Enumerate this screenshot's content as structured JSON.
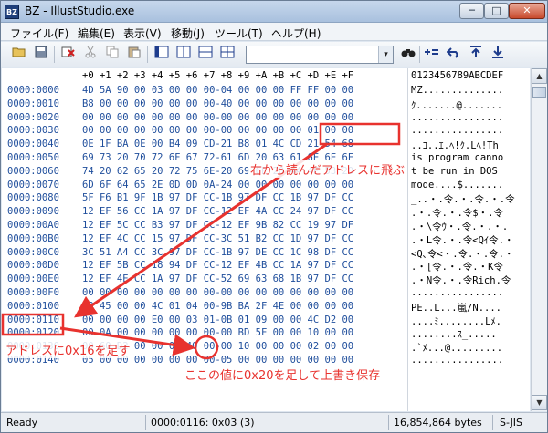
{
  "window": {
    "title": "BZ - IllustStudio.exe",
    "app_icon_text": "BZ",
    "minimize": "─",
    "maximize": "□",
    "close": "✕"
  },
  "menu": [
    "ファイル(F)",
    "編集(E)",
    "表示(V)",
    "移動(J)",
    "ツール(T)",
    "ヘルプ(H)"
  ],
  "toolbar": {
    "combo_value": "",
    "combo_arrow": "▾"
  },
  "hex": {
    "header_cols": "+0 +1 +2 +3 +4 +5 +6 +7 +8 +9 +A +B +C +D +E +F",
    "header_ascii": "0123456789ABCDEF",
    "rows": [
      {
        "addr": "0000:0000",
        "bytes": "4D 5A 90 00 03 00 00 00-04 00 00 00 FF FF 00 00",
        "ascii": "MZ.............."
      },
      {
        "addr": "0000:0010",
        "bytes": "B8 00 00 00 00 00 00 00-40 00 00 00 00 00 00 00",
        "ascii": "ｸ.......@......."
      },
      {
        "addr": "0000:0020",
        "bytes": "00 00 00 00 00 00 00 00-00 00 00 00 00 00 00 00",
        "ascii": "................"
      },
      {
        "addr": "0000:0030",
        "bytes": "00 00 00 00 00 00 00 00-00 00 00 00 00 01 00 00",
        "ascii": "................"
      },
      {
        "addr": "0000:0040",
        "bytes": "0E 1F BA 0E 00 B4 09 CD-21 B8 01 4C CD 21 54 68",
        "ascii": "..ｺ..ｴ.ﾍ!ｸ.Lﾍ!Th"
      },
      {
        "addr": "0000:0050",
        "bytes": "69 73 20 70 72 6F 67 72-61 6D 20 63 61 6E 6E 6F",
        "ascii": "is program canno"
      },
      {
        "addr": "0000:0060",
        "bytes": "74 20 62 65 20 72 75 6E-20 69 6E 20 44 4F 53 20",
        "ascii": "t be run in DOS "
      },
      {
        "addr": "0000:0070",
        "bytes": "6D 6F 64 65 2E 0D 0D 0A-24 00 00 00 00 00 00 00",
        "ascii": "mode....$......."
      },
      {
        "addr": "0000:0080",
        "bytes": "5F F6 B1 9F 1B 97 DF CC-1B 97 DF CC 1B 97 DF CC",
        "ascii": "_..・.令.・.令.・.令"
      },
      {
        "addr": "0000:0090",
        "bytes": "12 EF 56 CC 1A 97 DF CC-12 EF 4A CC 24 97 DF CC",
        "ascii": ".・.令.・.令$・.令"
      },
      {
        "addr": "0000:00A0",
        "bytes": "12 EF 5C CC B3 97 DF CC-12 EF 9B 82 CC 19 97 DF",
        "ascii": ".・\\令ｳ・.令.・.・."
      },
      {
        "addr": "0000:00B0",
        "bytes": "12 EF 4C CC 15 97 DF CC-3C 51 B2 CC 1D 97 DF CC",
        "ascii": ".・L令.・.令<Qｲ令.・"
      },
      {
        "addr": "0000:00C0",
        "bytes": "3C 51 A4 CC 3C 97 DF CC-1B 97 DE CC 1C 98 DF CC",
        "ascii": "<Q､令<・.令.・.令.・"
      },
      {
        "addr": "0000:00D0",
        "bytes": "12 EF 5B CC 18 94 DF CC-12 EF 4B CC 1A 97 DF CC",
        "ascii": ".・[令.・.令.・K令"
      },
      {
        "addr": "0000:00E0",
        "bytes": "12 EF 4E CC 1A 97 DF CC-52 69 63 68 1B 97 DF CC",
        "ascii": ".・N令.・.令Rich.令"
      },
      {
        "addr": "0000:00F0",
        "bytes": "00 00 00 00 00 00 00 00-00 00 00 00 00 00 00 00",
        "ascii": "................"
      },
      {
        "addr": "0000:0100",
        "bytes": "50 45 00 00 4C 01 04 00-9B BA 2F 4E 00 00 00 00",
        "ascii": "PE..L...嵐/N...."
      },
      {
        "addr": "0000:0110",
        "bytes": "00 00 00 00 E0 00 03 01-0B 01 09 00 00 4C D2 00",
        "ascii": "....ﾐ........Lﾒ."
      },
      {
        "addr": "0000:0120",
        "bytes": "00 0A 00 00 00 00 00 00-00 BD 5F 00 00 10 00 00",
        "ascii": "........ｽ_....."
      },
      {
        "addr": "0000:0130",
        "bytes": "00 60 D2 00 00 00 40 00-00 10 00 00 00 02 00 00",
        "ascii": ".`ﾒ...@........."
      },
      {
        "addr": "0000:0140",
        "bytes": "05 00 00 00 00 00 00 00-05 00 00 00 00 00 00 00",
        "ascii": "................"
      }
    ]
  },
  "status": {
    "state": "Ready",
    "cursor": "0000:0116: 0x03 (3)",
    "size": "16,854,864 bytes",
    "encoding": "S-JIS"
  },
  "annotations": {
    "jump_note": "右から読んだアドレスに飛ぶ",
    "add_offset_note": "アドレスに0x16を足す",
    "overwrite_note": "ここの値に0x20を足して上書き保存",
    "accent_color": "#e8322e"
  },
  "icons": {
    "open": "folder-open-icon",
    "save": "save-icon",
    "cut": "cut-icon",
    "copy": "copy-icon",
    "paste": "paste-icon",
    "find": "binoculars-icon"
  }
}
